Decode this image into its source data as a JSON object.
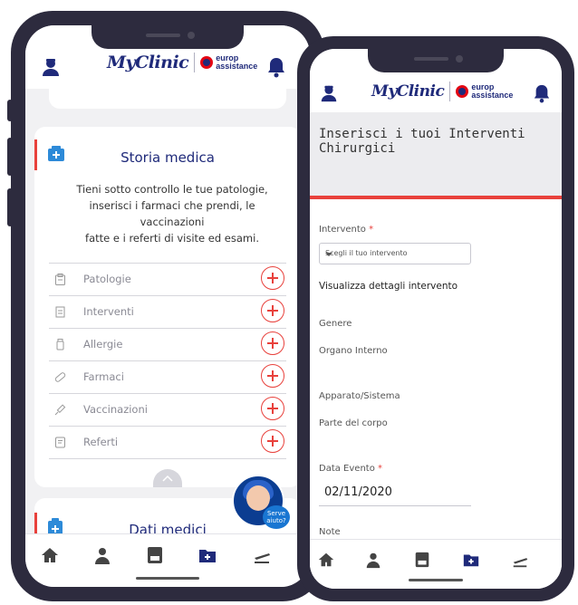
{
  "left_phone": {
    "logo": {
      "brand": "MyClinic",
      "partner_line1": "europ",
      "partner_line2": "assistance"
    },
    "storia_card": {
      "title": "Storia medica",
      "description_lines": [
        "Tieni sotto controllo le tue patologie,",
        "inserisci i farmaci che prendi, le vaccinazioni",
        "fatte e i referti di visite ed esami."
      ],
      "items": [
        {
          "label": "Patologie",
          "icon": "clipboard-icon"
        },
        {
          "label": "Interventi",
          "icon": "bed-icon"
        },
        {
          "label": "Allergie",
          "icon": "jar-icon"
        },
        {
          "label": "Farmaci",
          "icon": "pill-icon"
        },
        {
          "label": "Vaccinazioni",
          "icon": "syringe-icon"
        },
        {
          "label": "Referti",
          "icon": "report-icon"
        }
      ]
    },
    "dati_card": {
      "title": "Dati medici"
    },
    "assistant_badge": {
      "line1": "Serve",
      "line2": "aiuto?"
    }
  },
  "right_phone": {
    "logo": {
      "brand": "MyClinic",
      "partner_line1": "europ",
      "partner_line2": "assistance"
    },
    "form": {
      "title_line1": "Inserisci i tuoi Interventi",
      "title_line2": "Chirurgici",
      "intervento_label": "Intervento",
      "required_mark": "*",
      "intervento_placeholder": "Scegli il tuo intervento",
      "details_link": "Visualizza dettagli intervento",
      "genere_label": "Genere",
      "organo_label": "Organo Interno",
      "apparato_label": "Apparato/Sistema",
      "parte_label": "Parte del corpo",
      "data_evento_label": "Data Evento",
      "data_evento_value": "02/11/2020",
      "note_label": "Note"
    }
  },
  "colors": {
    "accent": "#e8413c",
    "brand": "#1f2a7a",
    "frame": "#2d2b3e"
  }
}
